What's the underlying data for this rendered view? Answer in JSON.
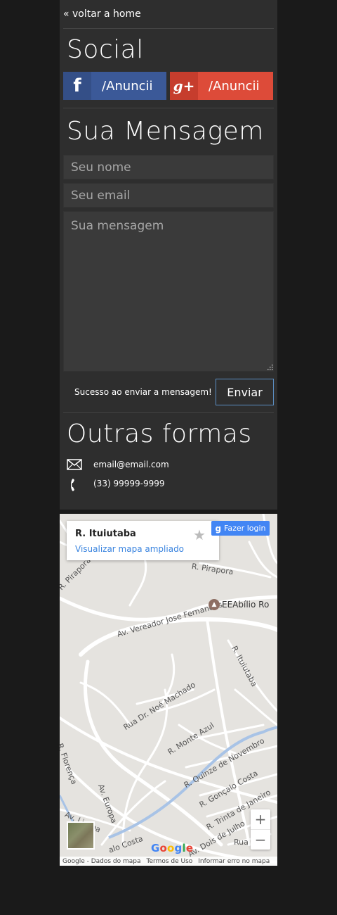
{
  "nav": {
    "back_label": "« voltar a home"
  },
  "social": {
    "title": "Social",
    "facebook": {
      "icon": "f",
      "label": "/Anuncii",
      "color": "#3b5998"
    },
    "googleplus": {
      "icon": "g+",
      "label": "/Anuncii",
      "color": "#dd4b39"
    }
  },
  "message": {
    "title": "Sua Mensagem",
    "name_placeholder": "Seu nome",
    "email_placeholder": "Seu email",
    "message_placeholder": "Sua mensagem",
    "status": "Sucesso ao enviar a mensagem!",
    "send_label": "Enviar"
  },
  "other": {
    "title": "Outras formas",
    "email": "email@email.com",
    "phone": "(33) 99999-9999"
  },
  "map": {
    "place_title": "R. Ituiutaba",
    "view_larger": "Visualizar mapa ampliado",
    "login_label": "Fazer login",
    "poi_label": "EEAbílio Ro",
    "logo": "Google",
    "zoom_in": "+",
    "zoom_out": "−",
    "footer": {
      "data": "Google - Dados do mapa",
      "terms": "Termos de Uso",
      "report": "Informar erro no mapa"
    },
    "streets": {
      "pirapora_1": "R. Pirapora",
      "pirapora_2": "R. Pirapora",
      "vereador": "Av. Vereador Jose Fernandes",
      "ituiutaba": "R. Ituiutaba",
      "noe": "Rua Dr. Noé Machado",
      "monte_azul": "R. Monte Azul",
      "florenca": "R. Florença",
      "europa": "Av. Europa",
      "lisboa": "Av. Lisboa",
      "quinze": "R. Quinze de Novembro",
      "goncalo_1": "R. Gonçalo Costa",
      "goncalo_2": "alo Costa",
      "trinta": "R. Trinta de Janeiro",
      "dois": "Av. Dois de Julho",
      "rua": "Rua"
    }
  }
}
